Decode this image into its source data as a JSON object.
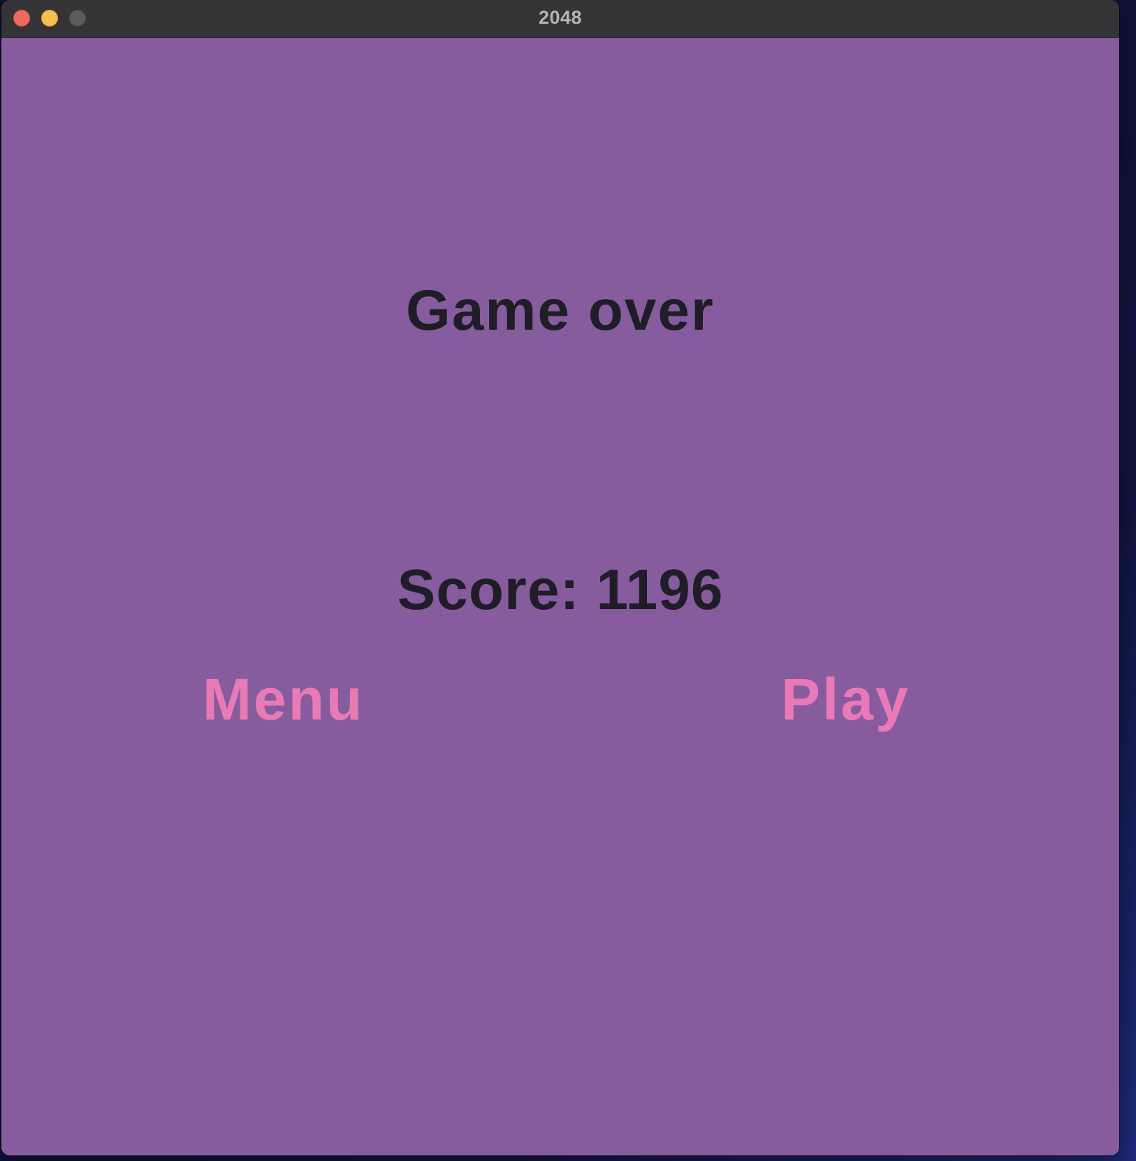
{
  "window": {
    "title": "2048"
  },
  "colors": {
    "background": "#875c9f",
    "text_dark": "#1f1e28",
    "button_pink": "#ea7ab5",
    "titlebar": "#343437"
  },
  "game_over": {
    "title": "Game over",
    "score_text": "Score: 1196",
    "score_value": 1196
  },
  "buttons": {
    "menu_label": "Menu",
    "play_label": "Play"
  }
}
